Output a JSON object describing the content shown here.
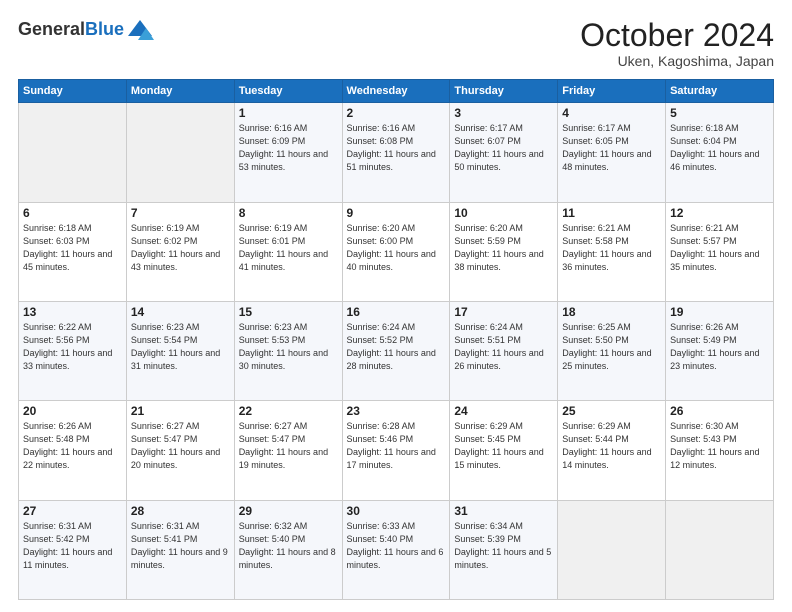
{
  "header": {
    "logo_general": "General",
    "logo_blue": "Blue",
    "month_title": "October 2024",
    "location": "Uken, Kagoshima, Japan"
  },
  "weekdays": [
    "Sunday",
    "Monday",
    "Tuesday",
    "Wednesday",
    "Thursday",
    "Friday",
    "Saturday"
  ],
  "weeks": [
    [
      {
        "day": "",
        "info": ""
      },
      {
        "day": "",
        "info": ""
      },
      {
        "day": "1",
        "info": "Sunrise: 6:16 AM\nSunset: 6:09 PM\nDaylight: 11 hours and 53 minutes."
      },
      {
        "day": "2",
        "info": "Sunrise: 6:16 AM\nSunset: 6:08 PM\nDaylight: 11 hours and 51 minutes."
      },
      {
        "day": "3",
        "info": "Sunrise: 6:17 AM\nSunset: 6:07 PM\nDaylight: 11 hours and 50 minutes."
      },
      {
        "day": "4",
        "info": "Sunrise: 6:17 AM\nSunset: 6:05 PM\nDaylight: 11 hours and 48 minutes."
      },
      {
        "day": "5",
        "info": "Sunrise: 6:18 AM\nSunset: 6:04 PM\nDaylight: 11 hours and 46 minutes."
      }
    ],
    [
      {
        "day": "6",
        "info": "Sunrise: 6:18 AM\nSunset: 6:03 PM\nDaylight: 11 hours and 45 minutes."
      },
      {
        "day": "7",
        "info": "Sunrise: 6:19 AM\nSunset: 6:02 PM\nDaylight: 11 hours and 43 minutes."
      },
      {
        "day": "8",
        "info": "Sunrise: 6:19 AM\nSunset: 6:01 PM\nDaylight: 11 hours and 41 minutes."
      },
      {
        "day": "9",
        "info": "Sunrise: 6:20 AM\nSunset: 6:00 PM\nDaylight: 11 hours and 40 minutes."
      },
      {
        "day": "10",
        "info": "Sunrise: 6:20 AM\nSunset: 5:59 PM\nDaylight: 11 hours and 38 minutes."
      },
      {
        "day": "11",
        "info": "Sunrise: 6:21 AM\nSunset: 5:58 PM\nDaylight: 11 hours and 36 minutes."
      },
      {
        "day": "12",
        "info": "Sunrise: 6:21 AM\nSunset: 5:57 PM\nDaylight: 11 hours and 35 minutes."
      }
    ],
    [
      {
        "day": "13",
        "info": "Sunrise: 6:22 AM\nSunset: 5:56 PM\nDaylight: 11 hours and 33 minutes."
      },
      {
        "day": "14",
        "info": "Sunrise: 6:23 AM\nSunset: 5:54 PM\nDaylight: 11 hours and 31 minutes."
      },
      {
        "day": "15",
        "info": "Sunrise: 6:23 AM\nSunset: 5:53 PM\nDaylight: 11 hours and 30 minutes."
      },
      {
        "day": "16",
        "info": "Sunrise: 6:24 AM\nSunset: 5:52 PM\nDaylight: 11 hours and 28 minutes."
      },
      {
        "day": "17",
        "info": "Sunrise: 6:24 AM\nSunset: 5:51 PM\nDaylight: 11 hours and 26 minutes."
      },
      {
        "day": "18",
        "info": "Sunrise: 6:25 AM\nSunset: 5:50 PM\nDaylight: 11 hours and 25 minutes."
      },
      {
        "day": "19",
        "info": "Sunrise: 6:26 AM\nSunset: 5:49 PM\nDaylight: 11 hours and 23 minutes."
      }
    ],
    [
      {
        "day": "20",
        "info": "Sunrise: 6:26 AM\nSunset: 5:48 PM\nDaylight: 11 hours and 22 minutes."
      },
      {
        "day": "21",
        "info": "Sunrise: 6:27 AM\nSunset: 5:47 PM\nDaylight: 11 hours and 20 minutes."
      },
      {
        "day": "22",
        "info": "Sunrise: 6:27 AM\nSunset: 5:47 PM\nDaylight: 11 hours and 19 minutes."
      },
      {
        "day": "23",
        "info": "Sunrise: 6:28 AM\nSunset: 5:46 PM\nDaylight: 11 hours and 17 minutes."
      },
      {
        "day": "24",
        "info": "Sunrise: 6:29 AM\nSunset: 5:45 PM\nDaylight: 11 hours and 15 minutes."
      },
      {
        "day": "25",
        "info": "Sunrise: 6:29 AM\nSunset: 5:44 PM\nDaylight: 11 hours and 14 minutes."
      },
      {
        "day": "26",
        "info": "Sunrise: 6:30 AM\nSunset: 5:43 PM\nDaylight: 11 hours and 12 minutes."
      }
    ],
    [
      {
        "day": "27",
        "info": "Sunrise: 6:31 AM\nSunset: 5:42 PM\nDaylight: 11 hours and 11 minutes."
      },
      {
        "day": "28",
        "info": "Sunrise: 6:31 AM\nSunset: 5:41 PM\nDaylight: 11 hours and 9 minutes."
      },
      {
        "day": "29",
        "info": "Sunrise: 6:32 AM\nSunset: 5:40 PM\nDaylight: 11 hours and 8 minutes."
      },
      {
        "day": "30",
        "info": "Sunrise: 6:33 AM\nSunset: 5:40 PM\nDaylight: 11 hours and 6 minutes."
      },
      {
        "day": "31",
        "info": "Sunrise: 6:34 AM\nSunset: 5:39 PM\nDaylight: 11 hours and 5 minutes."
      },
      {
        "day": "",
        "info": ""
      },
      {
        "day": "",
        "info": ""
      }
    ]
  ]
}
